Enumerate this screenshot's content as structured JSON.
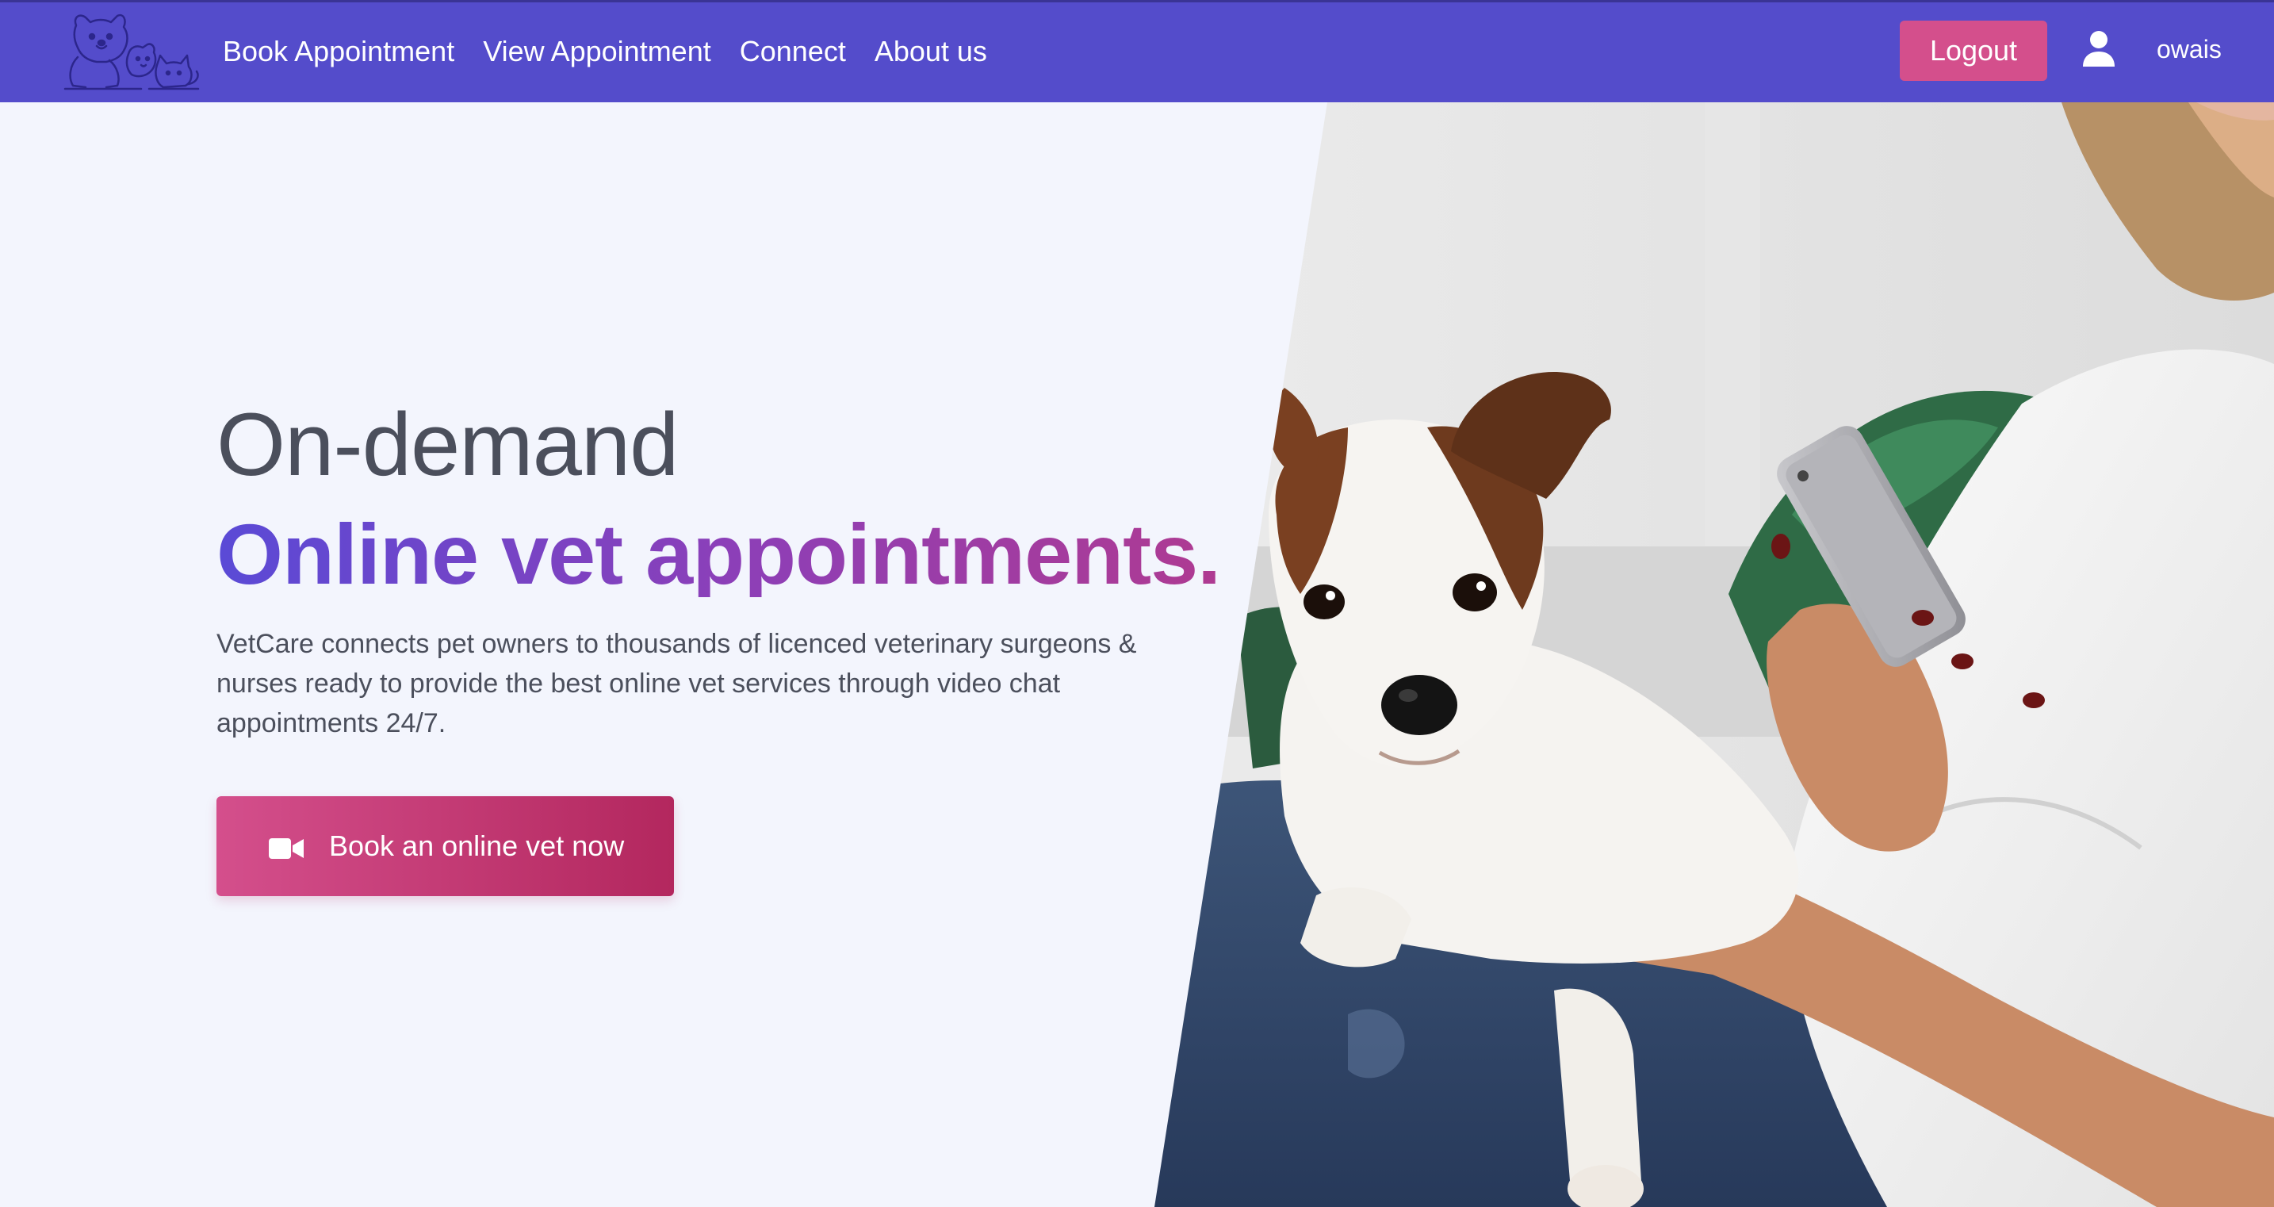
{
  "nav": {
    "links": [
      {
        "label": "Book Appointment"
      },
      {
        "label": "View Appointment"
      },
      {
        "label": "Connect"
      },
      {
        "label": "About us"
      }
    ],
    "logout_label": "Logout",
    "user_icon": "user-icon",
    "username": "owais",
    "logo_icon": "pets-logo"
  },
  "hero": {
    "headline_top": "On-demand",
    "headline_main": "Online vet appointments.",
    "description": "VetCare connects pet owners to thousands of licenced veterinary surgeons & nurses ready to provide the best online vet services through video chat appointments 24/7.",
    "cta_label": "Book an online vet now",
    "cta_icon": "video-camera-icon"
  },
  "colors": {
    "navbar": "#544ccb",
    "accent": "#d44f8c",
    "cta_gradient_end": "#b3275e",
    "headline_gradient_start": "#5a4ad6",
    "headline_gradient_end": "#b13a8f",
    "page_background": "#f3f5fd"
  }
}
